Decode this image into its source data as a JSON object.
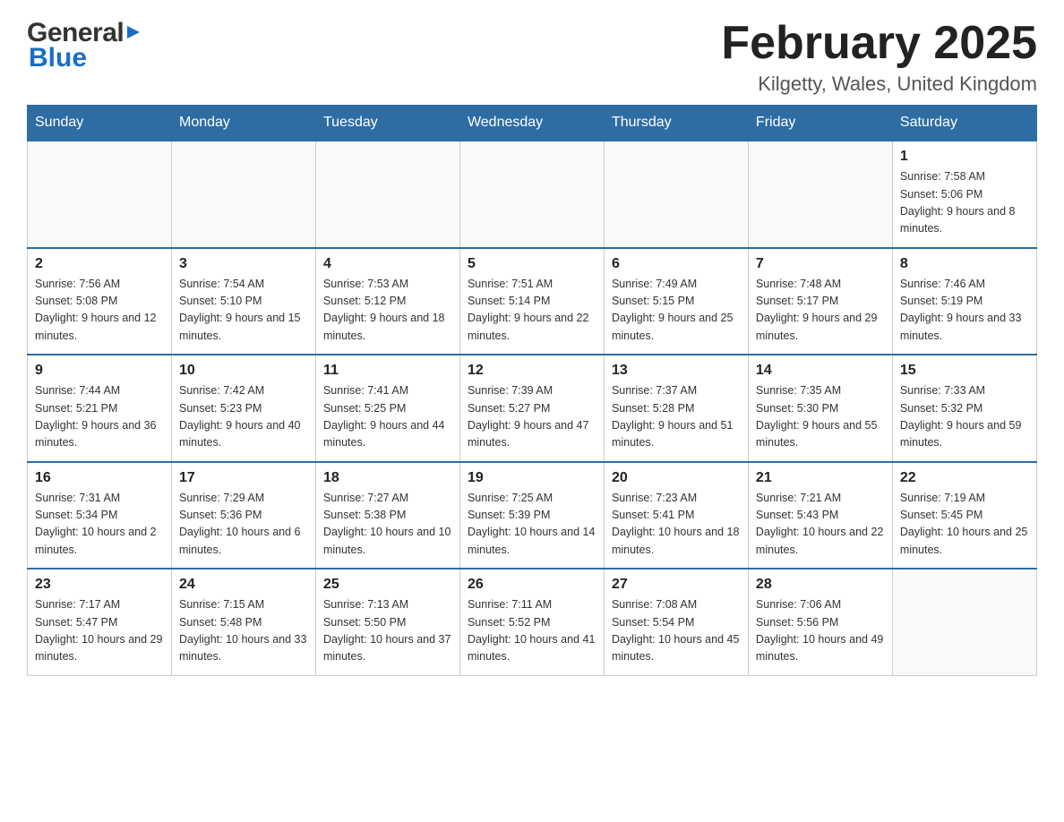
{
  "logo": {
    "text_general": "General",
    "triangle": "▶",
    "text_blue": "Blue"
  },
  "title": "February 2025",
  "location": "Kilgetty, Wales, United Kingdom",
  "days_of_week": [
    "Sunday",
    "Monday",
    "Tuesday",
    "Wednesday",
    "Thursday",
    "Friday",
    "Saturday"
  ],
  "weeks": [
    [
      {
        "day": "",
        "info": ""
      },
      {
        "day": "",
        "info": ""
      },
      {
        "day": "",
        "info": ""
      },
      {
        "day": "",
        "info": ""
      },
      {
        "day": "",
        "info": ""
      },
      {
        "day": "",
        "info": ""
      },
      {
        "day": "1",
        "info": "Sunrise: 7:58 AM\nSunset: 5:06 PM\nDaylight: 9 hours and 8 minutes."
      }
    ],
    [
      {
        "day": "2",
        "info": "Sunrise: 7:56 AM\nSunset: 5:08 PM\nDaylight: 9 hours and 12 minutes."
      },
      {
        "day": "3",
        "info": "Sunrise: 7:54 AM\nSunset: 5:10 PM\nDaylight: 9 hours and 15 minutes."
      },
      {
        "day": "4",
        "info": "Sunrise: 7:53 AM\nSunset: 5:12 PM\nDaylight: 9 hours and 18 minutes."
      },
      {
        "day": "5",
        "info": "Sunrise: 7:51 AM\nSunset: 5:14 PM\nDaylight: 9 hours and 22 minutes."
      },
      {
        "day": "6",
        "info": "Sunrise: 7:49 AM\nSunset: 5:15 PM\nDaylight: 9 hours and 25 minutes."
      },
      {
        "day": "7",
        "info": "Sunrise: 7:48 AM\nSunset: 5:17 PM\nDaylight: 9 hours and 29 minutes."
      },
      {
        "day": "8",
        "info": "Sunrise: 7:46 AM\nSunset: 5:19 PM\nDaylight: 9 hours and 33 minutes."
      }
    ],
    [
      {
        "day": "9",
        "info": "Sunrise: 7:44 AM\nSunset: 5:21 PM\nDaylight: 9 hours and 36 minutes."
      },
      {
        "day": "10",
        "info": "Sunrise: 7:42 AM\nSunset: 5:23 PM\nDaylight: 9 hours and 40 minutes."
      },
      {
        "day": "11",
        "info": "Sunrise: 7:41 AM\nSunset: 5:25 PM\nDaylight: 9 hours and 44 minutes."
      },
      {
        "day": "12",
        "info": "Sunrise: 7:39 AM\nSunset: 5:27 PM\nDaylight: 9 hours and 47 minutes."
      },
      {
        "day": "13",
        "info": "Sunrise: 7:37 AM\nSunset: 5:28 PM\nDaylight: 9 hours and 51 minutes."
      },
      {
        "day": "14",
        "info": "Sunrise: 7:35 AM\nSunset: 5:30 PM\nDaylight: 9 hours and 55 minutes."
      },
      {
        "day": "15",
        "info": "Sunrise: 7:33 AM\nSunset: 5:32 PM\nDaylight: 9 hours and 59 minutes."
      }
    ],
    [
      {
        "day": "16",
        "info": "Sunrise: 7:31 AM\nSunset: 5:34 PM\nDaylight: 10 hours and 2 minutes."
      },
      {
        "day": "17",
        "info": "Sunrise: 7:29 AM\nSunset: 5:36 PM\nDaylight: 10 hours and 6 minutes."
      },
      {
        "day": "18",
        "info": "Sunrise: 7:27 AM\nSunset: 5:38 PM\nDaylight: 10 hours and 10 minutes."
      },
      {
        "day": "19",
        "info": "Sunrise: 7:25 AM\nSunset: 5:39 PM\nDaylight: 10 hours and 14 minutes."
      },
      {
        "day": "20",
        "info": "Sunrise: 7:23 AM\nSunset: 5:41 PM\nDaylight: 10 hours and 18 minutes."
      },
      {
        "day": "21",
        "info": "Sunrise: 7:21 AM\nSunset: 5:43 PM\nDaylight: 10 hours and 22 minutes."
      },
      {
        "day": "22",
        "info": "Sunrise: 7:19 AM\nSunset: 5:45 PM\nDaylight: 10 hours and 25 minutes."
      }
    ],
    [
      {
        "day": "23",
        "info": "Sunrise: 7:17 AM\nSunset: 5:47 PM\nDaylight: 10 hours and 29 minutes."
      },
      {
        "day": "24",
        "info": "Sunrise: 7:15 AM\nSunset: 5:48 PM\nDaylight: 10 hours and 33 minutes."
      },
      {
        "day": "25",
        "info": "Sunrise: 7:13 AM\nSunset: 5:50 PM\nDaylight: 10 hours and 37 minutes."
      },
      {
        "day": "26",
        "info": "Sunrise: 7:11 AM\nSunset: 5:52 PM\nDaylight: 10 hours and 41 minutes."
      },
      {
        "day": "27",
        "info": "Sunrise: 7:08 AM\nSunset: 5:54 PM\nDaylight: 10 hours and 45 minutes."
      },
      {
        "day": "28",
        "info": "Sunrise: 7:06 AM\nSunset: 5:56 PM\nDaylight: 10 hours and 49 minutes."
      },
      {
        "day": "",
        "info": ""
      }
    ]
  ]
}
